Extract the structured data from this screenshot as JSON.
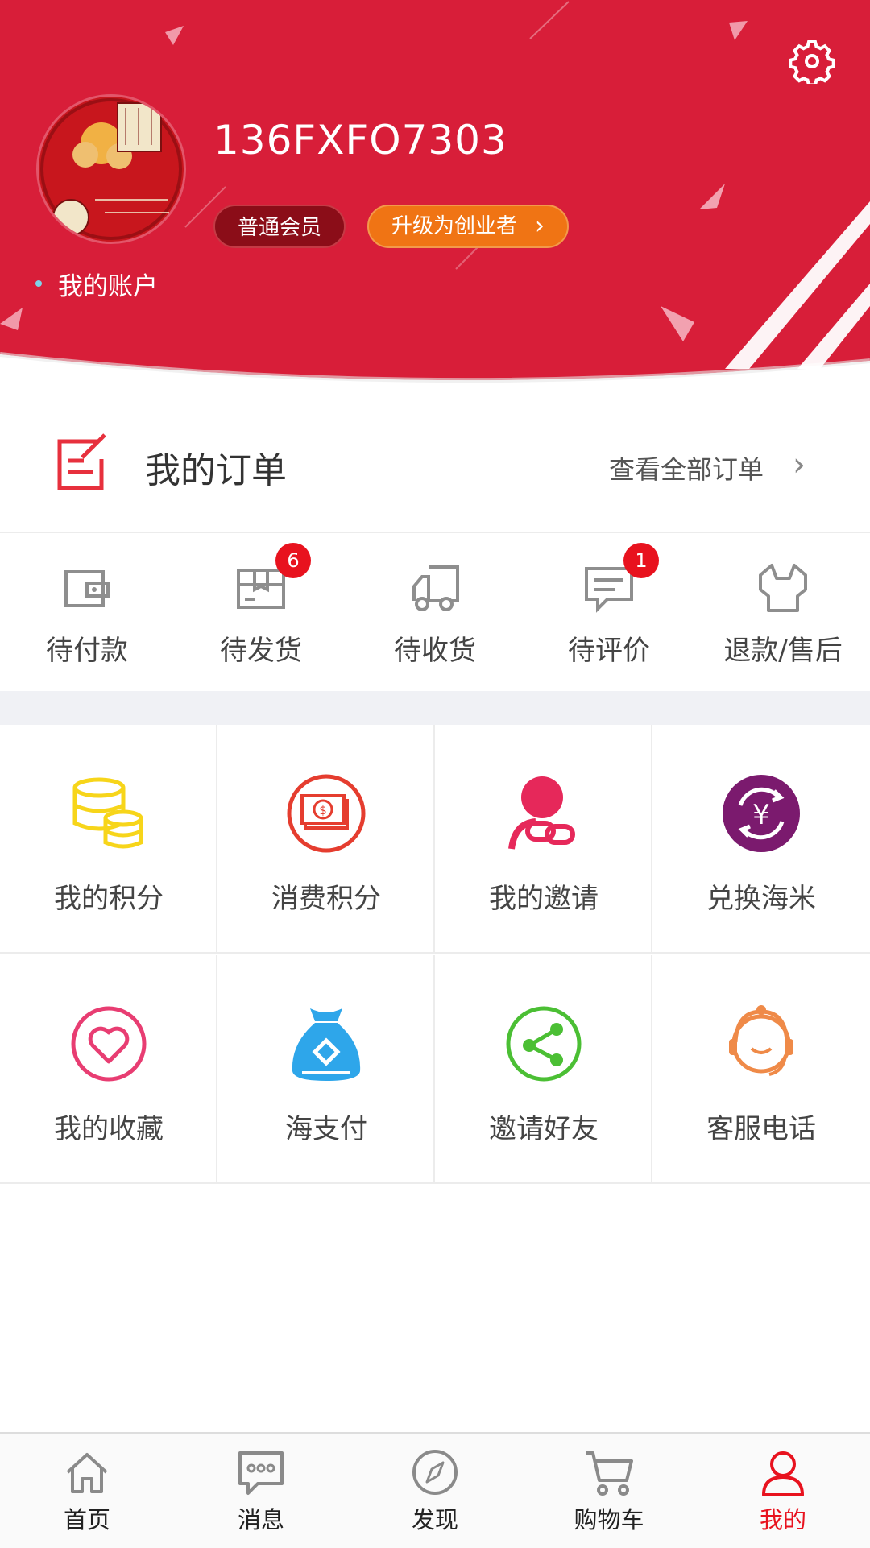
{
  "header": {
    "username": "136FXFO7303",
    "member_level": "普通会员",
    "upgrade_label": "升级为创业者",
    "account_label": "我的账户",
    "settings_icon": "gear-icon",
    "bg_color": "#d81e39"
  },
  "orders": {
    "title": "我的订单",
    "view_all": "查看全部订单",
    "statuses": [
      {
        "label": "待付款",
        "icon": "wallet-icon",
        "badge": ""
      },
      {
        "label": "待发货",
        "icon": "package-icon",
        "badge": "6"
      },
      {
        "label": "待收货",
        "icon": "truck-icon",
        "badge": ""
      },
      {
        "label": "待评价",
        "icon": "comment-icon",
        "badge": "1"
      },
      {
        "label": "退款/售后",
        "icon": "shirt-service-icon",
        "badge": ""
      }
    ]
  },
  "services": [
    {
      "label": "我的积分",
      "icon": "coin-stack-icon",
      "color": "#f7d51a"
    },
    {
      "label": "消费积分",
      "icon": "banknote-icon",
      "color": "#e53d2f"
    },
    {
      "label": "我的邀请",
      "icon": "user-link-icon",
      "color": "#e6285a"
    },
    {
      "label": "兑换海米",
      "icon": "yuan-exchange-icon",
      "color": "#7b1a6e"
    },
    {
      "label": "我的收藏",
      "icon": "heart-icon",
      "color": "#e83d72"
    },
    {
      "label": "海支付",
      "icon": "money-bag-icon",
      "color": "#2ea6ea"
    },
    {
      "label": "邀请好友",
      "icon": "share-icon",
      "color": "#4bbf34"
    },
    {
      "label": "客服电话",
      "icon": "customer-service-icon",
      "color": "#ef8a48"
    }
  ],
  "tabbar": {
    "items": [
      {
        "label": "首页",
        "icon": "home-icon"
      },
      {
        "label": "消息",
        "icon": "message-icon"
      },
      {
        "label": "发现",
        "icon": "compass-icon"
      },
      {
        "label": "购物车",
        "icon": "cart-icon"
      },
      {
        "label": "我的",
        "icon": "user-icon"
      }
    ],
    "active_color": "#e8121e"
  }
}
